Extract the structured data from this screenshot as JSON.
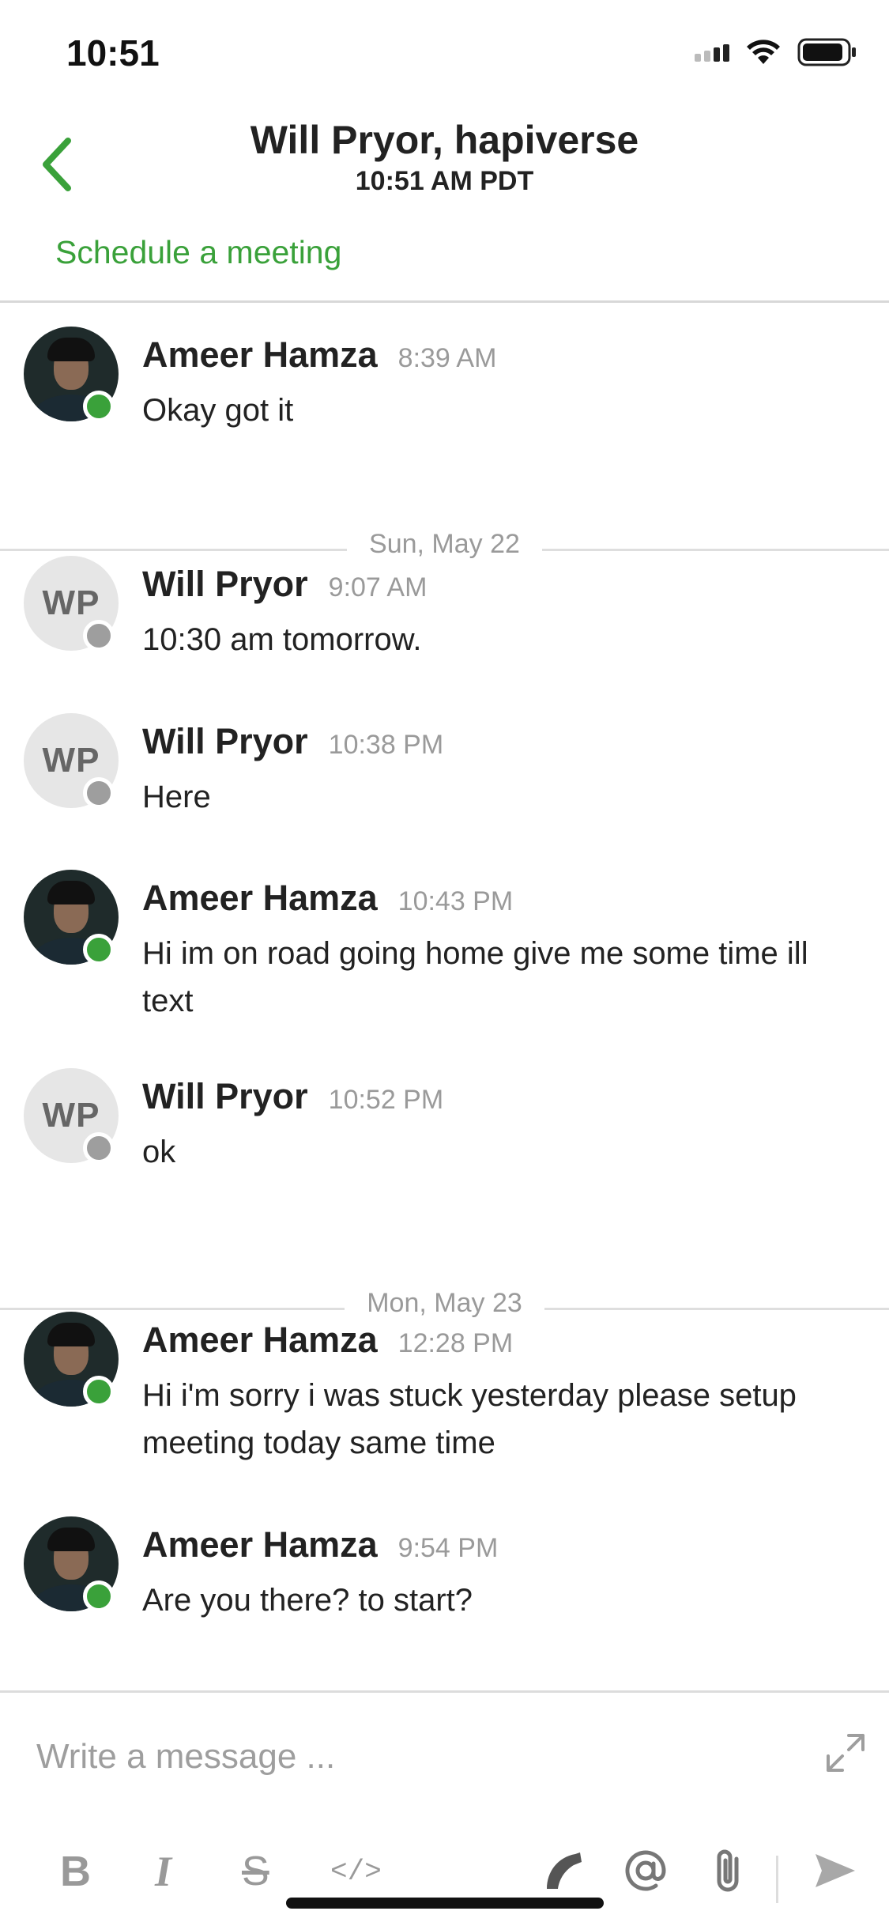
{
  "status_bar": {
    "time": "10:51"
  },
  "header": {
    "title": "Will Pryor, hapiverse",
    "subtitle": "10:51 AM PDT",
    "schedule_link": "Schedule a meeting"
  },
  "messages": [
    {
      "type": "message",
      "sender": "Ameer Hamza",
      "time": "8:39 AM",
      "text": "Okay got it",
      "avatar": "photo",
      "status": "online"
    },
    {
      "type": "divider",
      "label": "Sun, May 22"
    },
    {
      "type": "message",
      "sender": "Will Pryor",
      "time": "9:07 AM",
      "text": "10:30 am tomorrow.",
      "avatar": "WP",
      "status": "offline"
    },
    {
      "type": "message",
      "sender": "Will Pryor",
      "time": "10:38 PM",
      "text": "Here",
      "avatar": "WP",
      "status": "offline"
    },
    {
      "type": "message",
      "sender": "Ameer Hamza",
      "time": "10:43 PM",
      "text": "Hi im on road going home give me some time ill text",
      "avatar": "photo",
      "status": "online"
    },
    {
      "type": "message",
      "sender": "Will Pryor",
      "time": "10:52 PM",
      "text": "ok",
      "avatar": "WP",
      "status": "offline"
    },
    {
      "type": "divider",
      "label": "Mon, May 23"
    },
    {
      "type": "message",
      "sender": "Ameer Hamza",
      "time": "12:28 PM",
      "text": "Hi i'm sorry i was stuck yesterday please setup meeting today same time",
      "avatar": "photo",
      "status": "online"
    },
    {
      "type": "message",
      "sender": "Ameer Hamza",
      "time": "9:54 PM",
      "text": "Are you there? to start?",
      "avatar": "photo",
      "status": "online"
    }
  ],
  "composer": {
    "placeholder": "Write a message ...",
    "tools": {
      "bold": "B",
      "italic": "I",
      "strike": "S",
      "code": "</>"
    }
  },
  "colors": {
    "accent": "#3aa13a",
    "online": "#3aa13a",
    "offline": "#9e9e9e",
    "muted_text": "#9a9a9a"
  },
  "icons": [
    "back-chevron-icon",
    "signal-icon",
    "wifi-icon",
    "battery-icon",
    "expand-icon",
    "call-icon",
    "mention-icon",
    "attachment-icon",
    "send-icon"
  ]
}
